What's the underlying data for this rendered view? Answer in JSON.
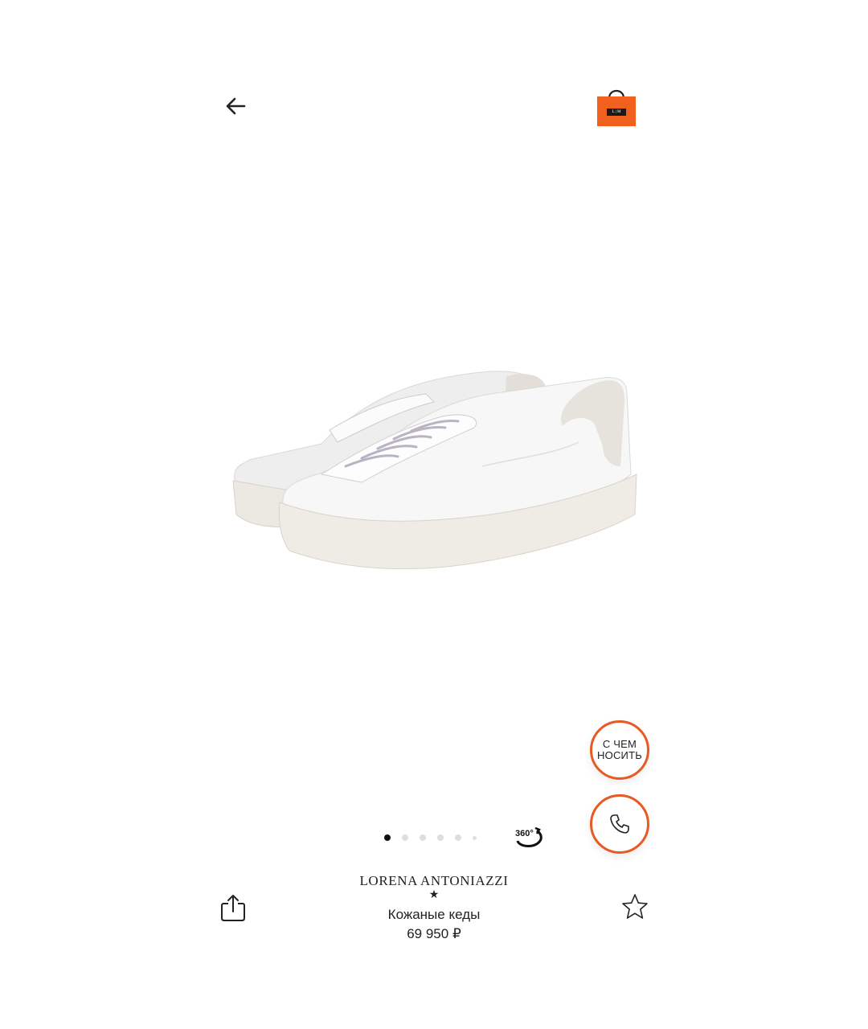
{
  "header": {
    "back_icon": "arrow-left-icon",
    "bag_icon": "shopping-bag-icon",
    "bag_logo_text": "L | M",
    "bag_color": "#f2601e"
  },
  "product": {
    "image": "white-leather-sneakers",
    "brand": "LORENA ANTONIAZZI",
    "brand_star": "★",
    "title": "Кожаные кеды",
    "price": "69 950 ₽"
  },
  "actions": {
    "wear_with_label_line1": "С ЧЕМ",
    "wear_with_label_line2": "НОСИТЬ",
    "call_icon": "phone-icon",
    "share_icon": "share-icon",
    "favorite_icon": "star-outline-icon",
    "accent_color": "#e85a23"
  },
  "gallery": {
    "pages": 6,
    "active_page": 1,
    "view360_label": "360°"
  }
}
